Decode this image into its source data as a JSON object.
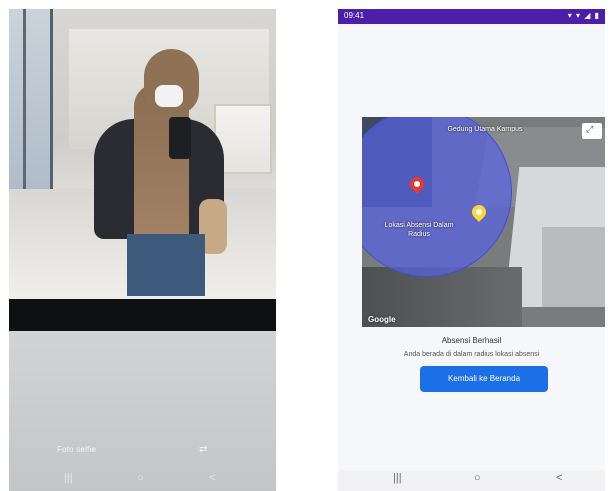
{
  "left_phone": {
    "mode_label": "Foto selfie",
    "switch_icon": "camera-switch-icon",
    "nav": {
      "back": "|||",
      "home": "○",
      "recent": "<"
    }
  },
  "right_phone": {
    "status": {
      "time": "09:41",
      "icons": "▾ ▾ ◢ ▮"
    },
    "map": {
      "label_top": "Gedung Utama Kampus",
      "label_mid": "Lokasi Absensi Dalam Radius",
      "google": "Google",
      "fullscreen_icon": "fullscreen-icon",
      "circle_color": "#5662e6",
      "pin_colors": [
        "#e53935",
        "#fdd835"
      ]
    },
    "attendance": {
      "title": "Absensi Berhasil",
      "description": "Anda berada di dalam radius lokasi absensi",
      "button_label": "Kembali ke Beranda"
    },
    "nav": {
      "recent": "|||",
      "home": "○",
      "back": "<"
    }
  },
  "colors": {
    "status_bar": "#4b1fa8",
    "primary_button": "#1d6fe8"
  }
}
